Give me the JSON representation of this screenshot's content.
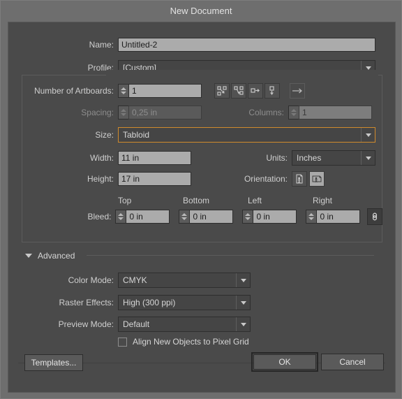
{
  "dialog": {
    "title": "New Document"
  },
  "fields": {
    "name_label": "Name:",
    "name_value": "Untitled-2",
    "profile_label": "Profile:",
    "profile_value": "[Custom]",
    "artboards_label": "Number of Artboards:",
    "artboards_value": "1",
    "spacing_label": "Spacing:",
    "spacing_value": "0,25 in",
    "columns_label": "Columns:",
    "columns_value": "1",
    "size_label": "Size:",
    "size_value": "Tabloid",
    "width_label": "Width:",
    "width_value": "11 in",
    "units_label": "Units:",
    "units_value": "Inches",
    "height_label": "Height:",
    "height_value": "17 in",
    "orientation_label": "Orientation:",
    "bleed_label": "Bleed:",
    "bleed_top_header": "Top",
    "bleed_bottom_header": "Bottom",
    "bleed_left_header": "Left",
    "bleed_right_header": "Right",
    "bleed_top_value": "0 in",
    "bleed_bottom_value": "0 in",
    "bleed_left_value": "0 in",
    "bleed_right_value": "0 in"
  },
  "advanced": {
    "section_label": "Advanced",
    "color_mode_label": "Color Mode:",
    "color_mode_value": "CMYK",
    "raster_effects_label": "Raster Effects:",
    "raster_effects_value": "High (300 ppi)",
    "preview_mode_label": "Preview Mode:",
    "preview_mode_value": "Default",
    "align_pixel_grid_label": "Align New Objects to Pixel Grid",
    "align_pixel_grid_checked": false
  },
  "footer": {
    "templates_label": "Templates...",
    "ok_label": "OK",
    "cancel_label": "Cancel"
  },
  "icons": {
    "arrange_grid_by_row": "grid-by-row-icon",
    "arrange_grid_by_column": "grid-by-column-icon",
    "arrange_by_row": "arrange-by-row-icon",
    "arrange_by_column": "arrange-by-column-icon",
    "layout_direction": "left-to-right-arrow-icon",
    "orientation_portrait": "portrait-icon",
    "orientation_landscape": "landscape-icon",
    "bleed_link": "link-chain-icon"
  },
  "colors": {
    "window_bg": "#6e6e6e",
    "panel_bg": "#4a4a4a",
    "input_bg": "#ababab",
    "focus_border": "#d08a2c",
    "text": "#d6d6d6"
  }
}
